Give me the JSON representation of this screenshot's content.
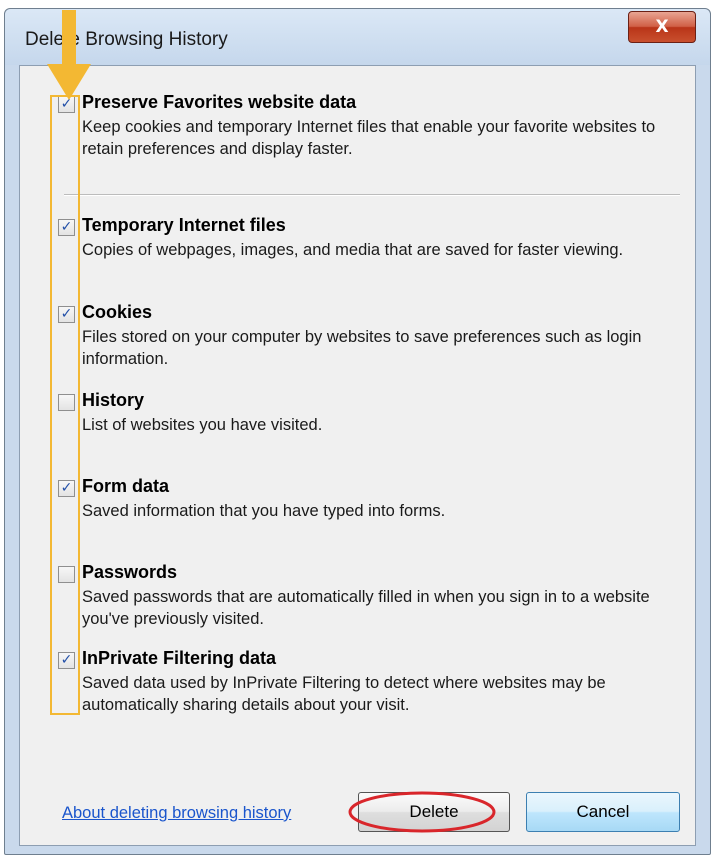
{
  "dialog": {
    "title": "Delete Browsing History",
    "close_label": "X"
  },
  "options": [
    {
      "label": "Preserve Favorites website data",
      "description": "Keep cookies and temporary Internet files that enable your favorite websites to retain preferences and display faster.",
      "checked": true
    },
    {
      "label": "Temporary Internet files",
      "description": "Copies of webpages, images, and media that are saved for faster viewing.",
      "checked": true
    },
    {
      "label": "Cookies",
      "description": "Files stored on your computer by websites to save preferences such as login information.",
      "checked": true
    },
    {
      "label": "History",
      "description": "List of websites you have visited.",
      "checked": false
    },
    {
      "label": "Form data",
      "description": "Saved information that you have typed into forms.",
      "checked": true
    },
    {
      "label": "Passwords",
      "description": "Saved passwords that are automatically filled in when you sign in to a website you've previously visited.",
      "checked": false
    },
    {
      "label": "InPrivate Filtering data",
      "description": "Saved data used by InPrivate Filtering to detect where websites may be automatically sharing details about your visit.",
      "checked": true
    }
  ],
  "footer": {
    "about_link": "About deleting browsing history",
    "delete_label": "Delete",
    "cancel_label": "Cancel"
  },
  "annotations": {
    "highlight_color": "#f3b833",
    "oval_color": "#d9262b",
    "arrow_icon": "down-arrow-icon"
  },
  "colors": {
    "link": "#1a55cc",
    "checkmark": "#2350a8",
    "titlebar": "#c5d7ec",
    "close_button": "#c9502e"
  }
}
